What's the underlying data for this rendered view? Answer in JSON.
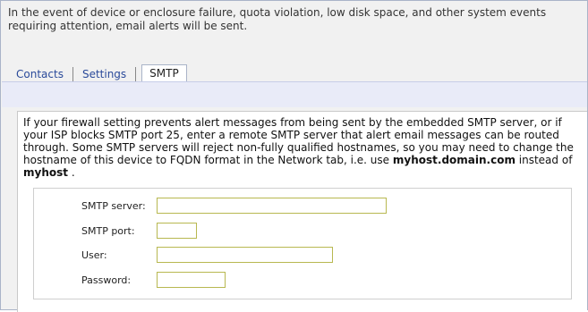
{
  "intro": {
    "text": "In the event of device or enclosure failure, quota violation, low disk space, and other system events requiring attention, email alerts will be sent."
  },
  "tabs": [
    {
      "label": "Contacts",
      "active": false
    },
    {
      "label": "Settings",
      "active": false
    },
    {
      "label": "SMTP",
      "active": true
    }
  ],
  "description": {
    "text_before": "If your firewall setting prevents alert messages from being sent by the embedded SMTP server, or if your ISP blocks SMTP port 25, enter a remote SMTP server that alert email messages can be routed through. Some SMTP servers will reject non-fully qualified hostnames, so you may need to change the hostname of this device to FQDN format in the Network tab, i.e. use",
    "example_fqdn": "myhost.domain.com",
    "text_middle": "instead of",
    "example_host": "myhost",
    "text_end": "."
  },
  "form": {
    "smtp_server": {
      "label": "SMTP server:",
      "value": ""
    },
    "smtp_port": {
      "label": "SMTP port:",
      "value": ""
    },
    "user": {
      "label": "User:",
      "value": ""
    },
    "password": {
      "label": "Password:",
      "value": ""
    }
  },
  "colors": {
    "tab_link": "#2a4a9a",
    "tab_bar": "#e9ebf8",
    "input_border": "#b8b850",
    "page_bg": "#f1f1f1"
  }
}
